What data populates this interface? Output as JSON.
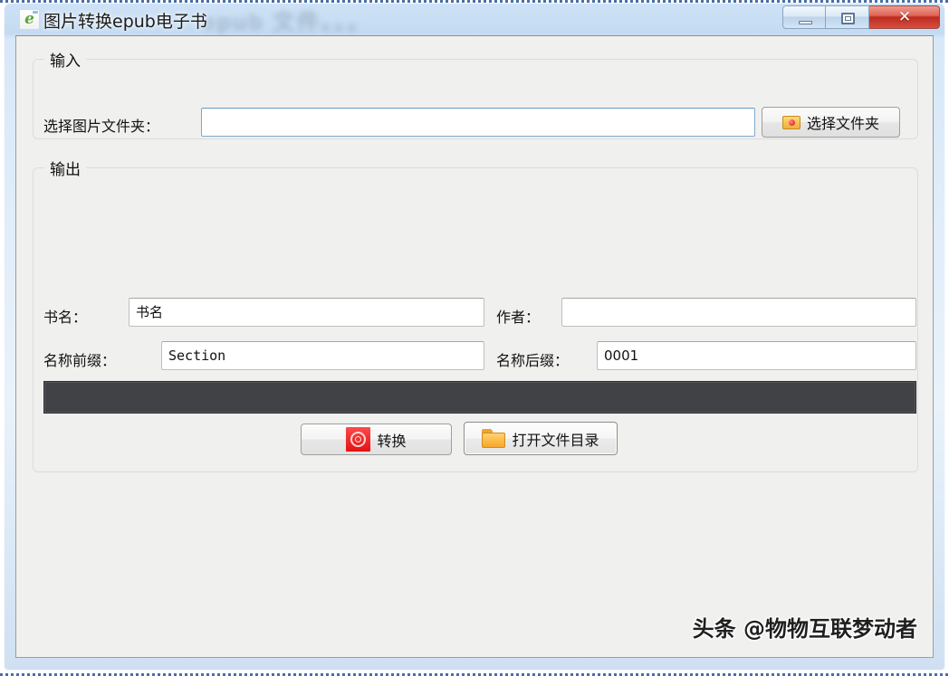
{
  "window": {
    "title": "图片转换epub电子书",
    "ghost_title": "epub 文件。。。",
    "app_icon": "epub-green-e-icon",
    "controls": {
      "minimize": "minimize-button",
      "restore": "restore-button",
      "close_glyph": "✕"
    }
  },
  "input_group": {
    "title": "输入",
    "folder_label": "选择图片文件夹：",
    "folder_value": "",
    "folder_placeholder": "",
    "choose_button": "选择文件夹",
    "choose_icon": "pick-folder-icon"
  },
  "output_group": {
    "title": "输出",
    "bookname_label": "书名：",
    "bookname_value": "书名",
    "author_label": "作者：",
    "author_value": "",
    "prefix_label": "名称前缀：",
    "prefix_value": "Section",
    "suffix_label": "名称后缀：",
    "suffix_value": "0001",
    "log_text": ""
  },
  "actions": {
    "convert_label": "转换",
    "convert_icon": "convert-refresh-icon",
    "open_dir_label": "打开文件目录",
    "open_dir_icon": "folder-icon"
  },
  "watermark": {
    "text": "头条 @物物互联梦动者"
  },
  "colors": {
    "accent_red": "#e41111",
    "folder_orange": "#f5a82c",
    "log_dark": "#414246",
    "frame_blue": "#c3dbf2",
    "client_bg": "#f0f0ee"
  }
}
